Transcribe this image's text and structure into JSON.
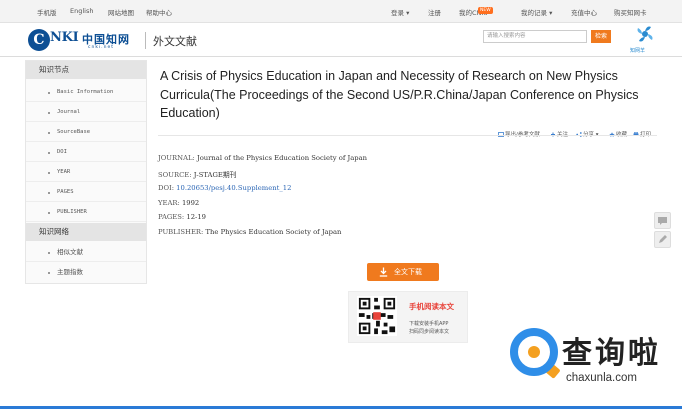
{
  "topbar": {
    "mobile": "手机版",
    "english": "English",
    "sitemap": "网站地图",
    "help": "帮助中心",
    "login": "登录",
    "register": "注册",
    "my_cnki": "我的CNKI",
    "hot_badge": "NEW",
    "my_records": "我的记录",
    "recharge": "充值中心",
    "buy_card": "购买知网卡"
  },
  "header": {
    "logo_letters": "NKI",
    "logo_cn": "中国知网",
    "logo_url": "cnki.net",
    "site_title": "外文文献",
    "search_placeholder": "请输入搜索内容",
    "search_button": "检索",
    "mascot_text": "知网羊"
  },
  "sidebar": {
    "section1_title": "知识节点",
    "nodes": [
      "Basic Information",
      "Journal",
      "SourceBase",
      "DOI",
      "YEAR",
      "PAGES",
      "PUBLISHER"
    ],
    "section2_title": "知识网络",
    "network": [
      "相似文献",
      "主题指数"
    ]
  },
  "article": {
    "title": "A Crisis of Physics Education in Japan and Necessity of Research on New Physics Curricula(The Proceedings of the Second US/P.R.China/Japan Conference on Physics Education)",
    "tools": {
      "export": "导出/参考文献",
      "follow": "关注",
      "share": "分享",
      "favorite": "收藏",
      "print": "打印"
    },
    "meta": {
      "journal_label": "JOURNAL:",
      "journal": "Journal of the Physics Education Society of Japan",
      "source_label": "SOURCE:",
      "source": "J-STAGE期刊",
      "doi_label": "DOI:",
      "doi": "10.20653/pesj.40.Supplement_12",
      "year_label": "YEAR:",
      "year": "1992",
      "pages_label": "PAGES:",
      "pages": "12-19",
      "publisher_label": "PUBLISHER:",
      "publisher": "The Physics Education Society of Japan"
    },
    "download_button": "全文下载"
  },
  "qr": {
    "title": "手机阅读本文",
    "line1": "下载安装手机APP",
    "line2": "扫码同步阅读本文"
  },
  "watermark": {
    "text": "查询啦",
    "url": "chaxunla.com"
  },
  "colors": {
    "brand_blue": "#0d4f94",
    "accent_orange": "#f07a1e",
    "link_blue": "#2b66b5"
  }
}
